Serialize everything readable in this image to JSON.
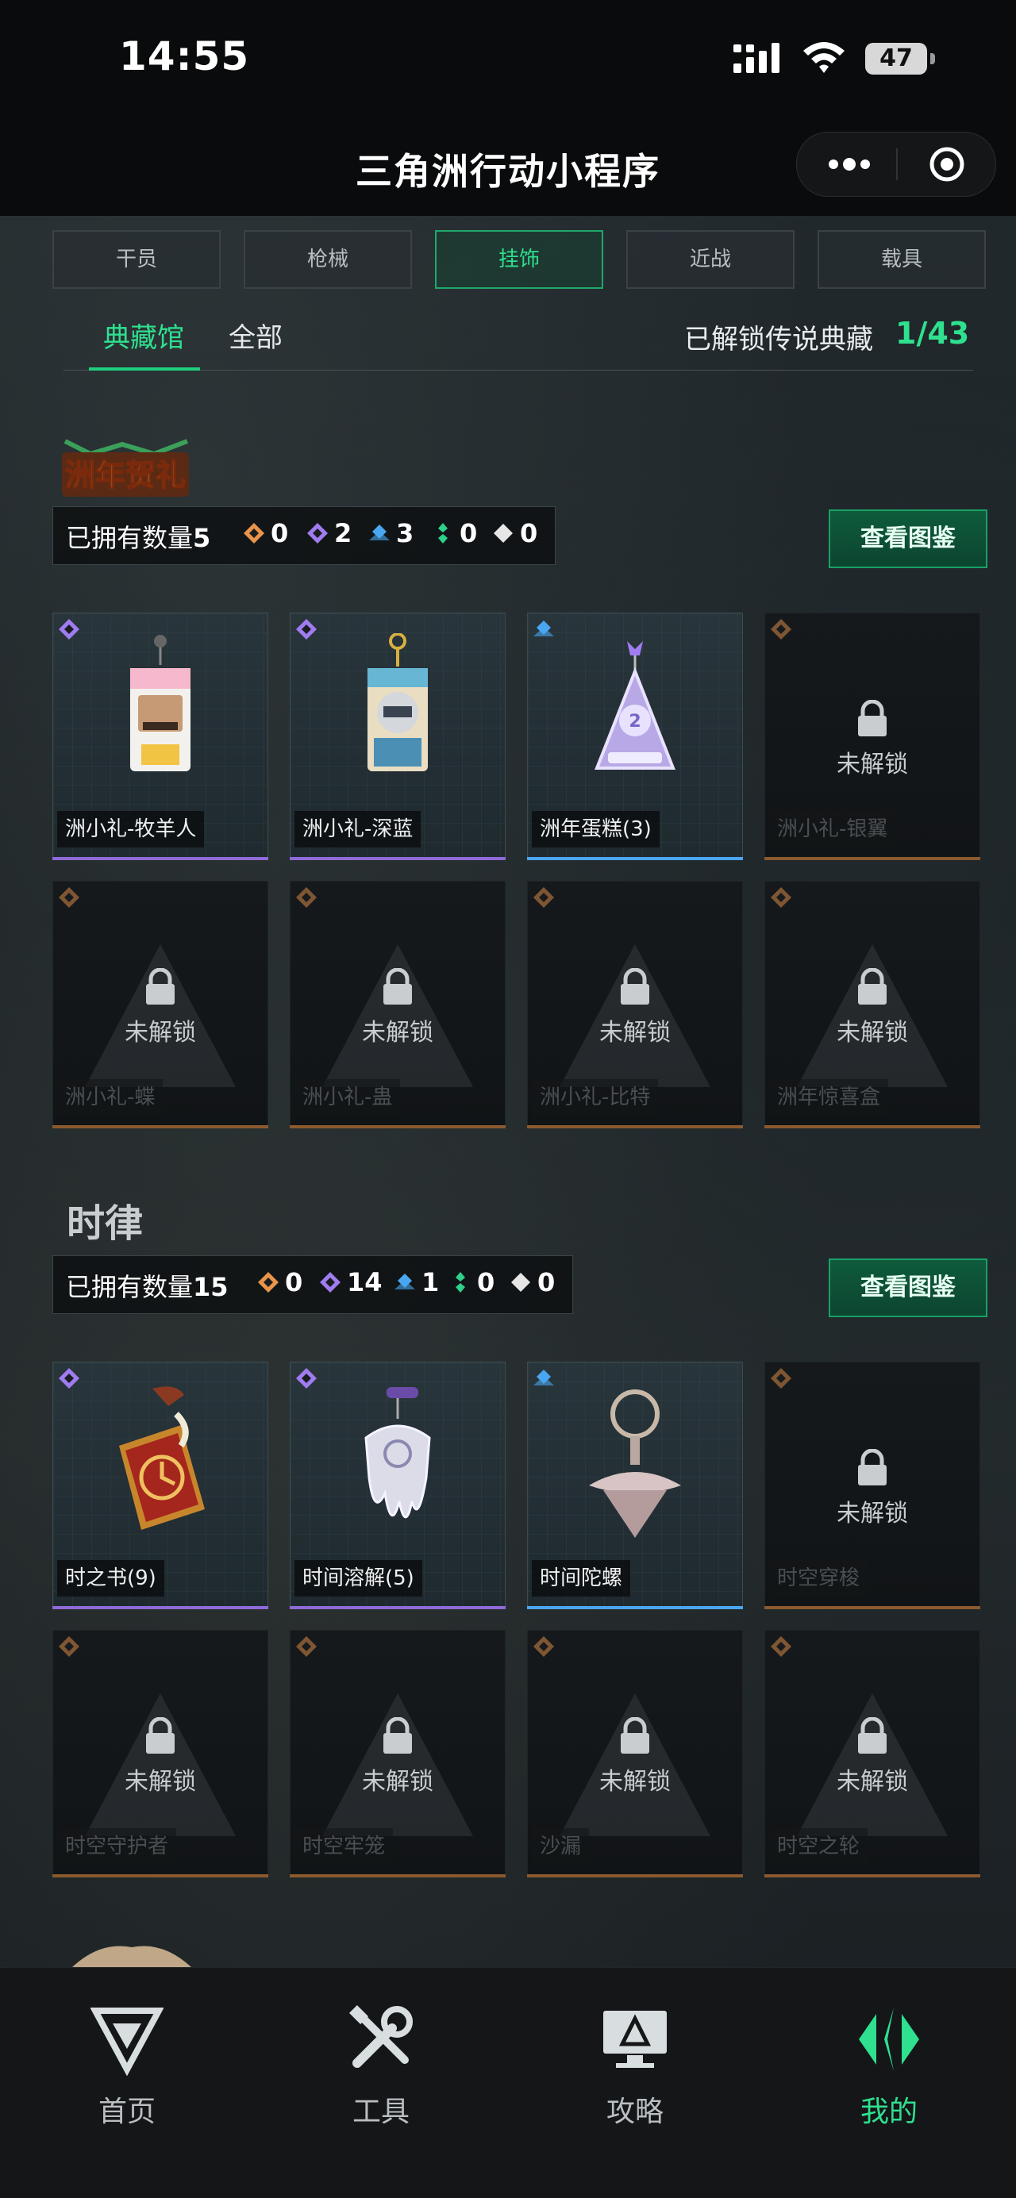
{
  "status_bar": {
    "time": "14:55",
    "battery": "47"
  },
  "title_bar": {
    "title": "三角洲行动小程序"
  },
  "category_tabs": [
    {
      "label": "干员",
      "active": false
    },
    {
      "label": "枪械",
      "active": false
    },
    {
      "label": "挂饰",
      "active": true
    },
    {
      "label": "近战",
      "active": false
    },
    {
      "label": "载具",
      "active": false
    }
  ],
  "sub_tabs": [
    {
      "label": "典藏馆",
      "active": true
    },
    {
      "label": "全部",
      "active": false
    }
  ],
  "unlock_summary": {
    "label": "已解锁传说典藏",
    "count": "1/43"
  },
  "colors": {
    "accent": "#2fe08f",
    "gold": "#e8944a",
    "purple": "#a07cf0",
    "blue": "#4aa6f0",
    "green": "#2fd08a",
    "white": "#e6e6e6"
  },
  "lock_text": "未解锁",
  "sections": [
    {
      "logo_text": "洲年贺礼",
      "owned_label": "已拥有数量",
      "owned_count": "5",
      "rarity_counts": [
        "0",
        "2",
        "3",
        "0",
        "0"
      ],
      "view_button": "查看图鉴",
      "items": [
        {
          "name": "洲小礼-牧羊人",
          "rarity": "purple",
          "locked": false
        },
        {
          "name": "洲小礼-深蓝",
          "rarity": "purple",
          "locked": false
        },
        {
          "name": "洲年蛋糕(3)",
          "rarity": "blue",
          "locked": false
        },
        {
          "name": "洲小礼-银翼",
          "rarity": "gold",
          "locked": true
        },
        {
          "name": "洲小礼-蝶",
          "rarity": "gold",
          "locked": true
        },
        {
          "name": "洲小礼-蛊",
          "rarity": "gold",
          "locked": true
        },
        {
          "name": "洲小礼-比特",
          "rarity": "gold",
          "locked": true
        },
        {
          "name": "洲年惊喜盒",
          "rarity": "gold",
          "locked": true
        }
      ]
    },
    {
      "logo_text": "时律",
      "owned_label": "已拥有数量",
      "owned_count": "15",
      "rarity_counts": [
        "0",
        "14",
        "1",
        "0",
        "0"
      ],
      "view_button": "查看图鉴",
      "items": [
        {
          "name": "时之书(9)",
          "rarity": "purple",
          "locked": false
        },
        {
          "name": "时间溶解(5)",
          "rarity": "purple",
          "locked": false
        },
        {
          "name": "时间陀螺",
          "rarity": "blue",
          "locked": false
        },
        {
          "name": "时空穿梭",
          "rarity": "gold",
          "locked": true
        },
        {
          "name": "时空守护者",
          "rarity": "gold",
          "locked": true
        },
        {
          "name": "时空牢笼",
          "rarity": "gold",
          "locked": true
        },
        {
          "name": "沙漏",
          "rarity": "gold",
          "locked": true
        },
        {
          "name": "时空之轮",
          "rarity": "gold",
          "locked": true
        }
      ]
    }
  ],
  "bottom_nav": [
    {
      "label": "首页",
      "icon": "home-logo-icon",
      "active": false
    },
    {
      "label": "工具",
      "icon": "tools-icon",
      "active": false
    },
    {
      "label": "攻略",
      "icon": "guide-monitor-icon",
      "active": false
    },
    {
      "label": "我的",
      "icon": "profile-logo-icon",
      "active": true
    }
  ]
}
